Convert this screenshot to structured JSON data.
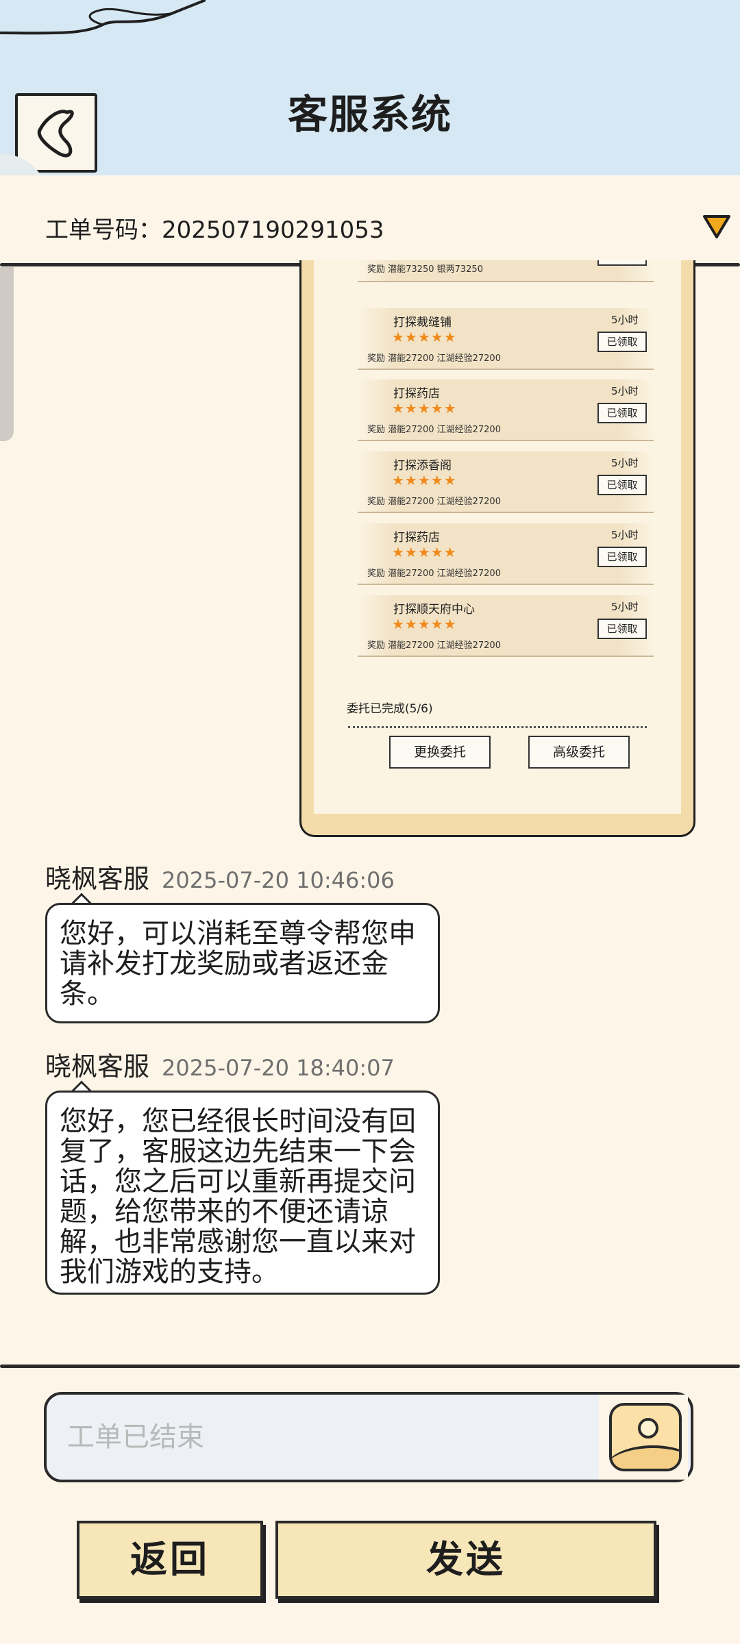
{
  "header": {
    "title": "客服系统"
  },
  "ticket": {
    "label": "工单号码：",
    "number": "202507190291053"
  },
  "screenshot": {
    "partial_row": {
      "reward": "奖励   潜能73250   银两73250"
    },
    "tasks": [
      {
        "name": "打探裁缝铺",
        "stars": "★★★★★",
        "time": "5小时",
        "button": "已领取",
        "reward": "奖励   潜能27200   江湖经验27200"
      },
      {
        "name": "打探药店",
        "stars": "★★★★★",
        "time": "5小时",
        "button": "已领取",
        "reward": "奖励   潜能27200   江湖经验27200"
      },
      {
        "name": "打探添香阁",
        "stars": "★★★★★",
        "time": "5小时",
        "button": "已领取",
        "reward": "奖励   潜能27200   江湖经验27200"
      },
      {
        "name": "打探药店",
        "stars": "★★★★★",
        "time": "5小时",
        "button": "已领取",
        "reward": "奖励   潜能27200   江湖经验27200"
      },
      {
        "name": "打探顺天府中心",
        "stars": "★★★★★",
        "time": "5小时",
        "button": "已领取",
        "reward": "奖励   潜能27200   江湖经验27200"
      }
    ],
    "status": "委托已完成(5/6)",
    "change_button": "更换委托",
    "advanced_button": "高级委托"
  },
  "messages": [
    {
      "sender": "晓枫客服",
      "time": "2025-07-20 10:46:06",
      "text": "您好，可以消耗至尊令帮您申请补发打龙奖励或者返还金条。"
    },
    {
      "sender": "晓枫客服",
      "time": "2025-07-20 18:40:07",
      "text": "您好，您已经很长时间没有回复了，客服这边先结束一下会话，您之后可以重新再提交问题，给您带来的不便还请谅解，也非常感谢您一直以来对我们游戏的支持。"
    }
  ],
  "input": {
    "placeholder": "工单已结束"
  },
  "buttons": {
    "back": "返回",
    "send": "发送"
  },
  "colors": {
    "header_bg": "#d6e8f3",
    "page_bg": "#fdf6e8",
    "button_bg": "#f7e6b8",
    "dropdown_arrow": "#f2a81d",
    "star": "#f08a1c"
  }
}
